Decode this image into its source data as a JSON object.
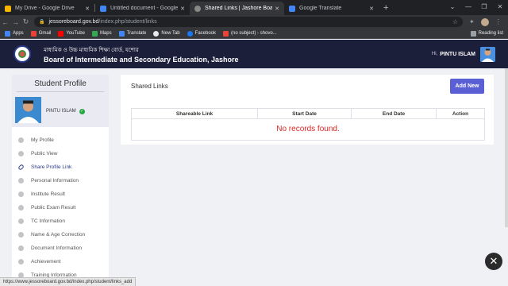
{
  "browser": {
    "tabs": [
      {
        "label": "My Drive - Google Drive",
        "color": "#f4b400",
        "active": false
      },
      {
        "label": "Untitled document - Google Docs",
        "color": "#4285f4",
        "active": false
      },
      {
        "label": "Shared Links | Jashore Board",
        "color": "#888888",
        "active": true
      },
      {
        "label": "Google Translate",
        "color": "#4285f4",
        "active": false
      }
    ],
    "url_host": "jessoreboard.gov.bd",
    "url_path": "/index.php/student/links",
    "bookmarks": [
      {
        "label": "Apps",
        "color": "#4285f4"
      },
      {
        "label": "Gmail",
        "color": "#ea4335"
      },
      {
        "label": "YouTube",
        "color": "#ff0000"
      },
      {
        "label": "Maps",
        "color": "#34a853"
      },
      {
        "label": "Translate",
        "color": "#4285f4"
      },
      {
        "label": "New Tab",
        "color": "#e8eaed"
      },
      {
        "label": "Facebook",
        "color": "#1877f2"
      },
      {
        "label": "(no subject) - shovo...",
        "color": "#ea4335"
      }
    ],
    "reading_list": "Reading list",
    "status_url": "https://www.jessoreboard.gov.bd/index.php/student/links_add"
  },
  "header": {
    "title_bn": "মাধ্যমিক ও উচ্চ মাধ্যমিক শিক্ষা বোর্ড, যশোর",
    "title_en": "Board of Intermediate and Secondary Education, Jashore",
    "greeting": "Hi,",
    "user_name": "PINTU ISLAM"
  },
  "sidebar": {
    "title": "Student Profile",
    "user_name": "PINTU ISLAM",
    "items": [
      {
        "label": "My Profile",
        "active": false
      },
      {
        "label": "Public View",
        "active": false
      },
      {
        "label": "Share Profile Link",
        "active": true
      },
      {
        "label": "Personal Information",
        "active": false
      },
      {
        "label": "Institute Result",
        "active": false
      },
      {
        "label": "Public Exam Result",
        "active": false
      },
      {
        "label": "TC Information",
        "active": false
      },
      {
        "label": "Name & Age Correction",
        "active": false
      },
      {
        "label": "Document Information",
        "active": false
      },
      {
        "label": "Achievement",
        "active": false
      },
      {
        "label": "Training Information",
        "active": false
      }
    ]
  },
  "main": {
    "title": "Shared Links",
    "add_button": "Add New",
    "columns": [
      "Shareable Link",
      "Start Date",
      "End Date",
      "Action"
    ],
    "empty_message": "No records found."
  }
}
